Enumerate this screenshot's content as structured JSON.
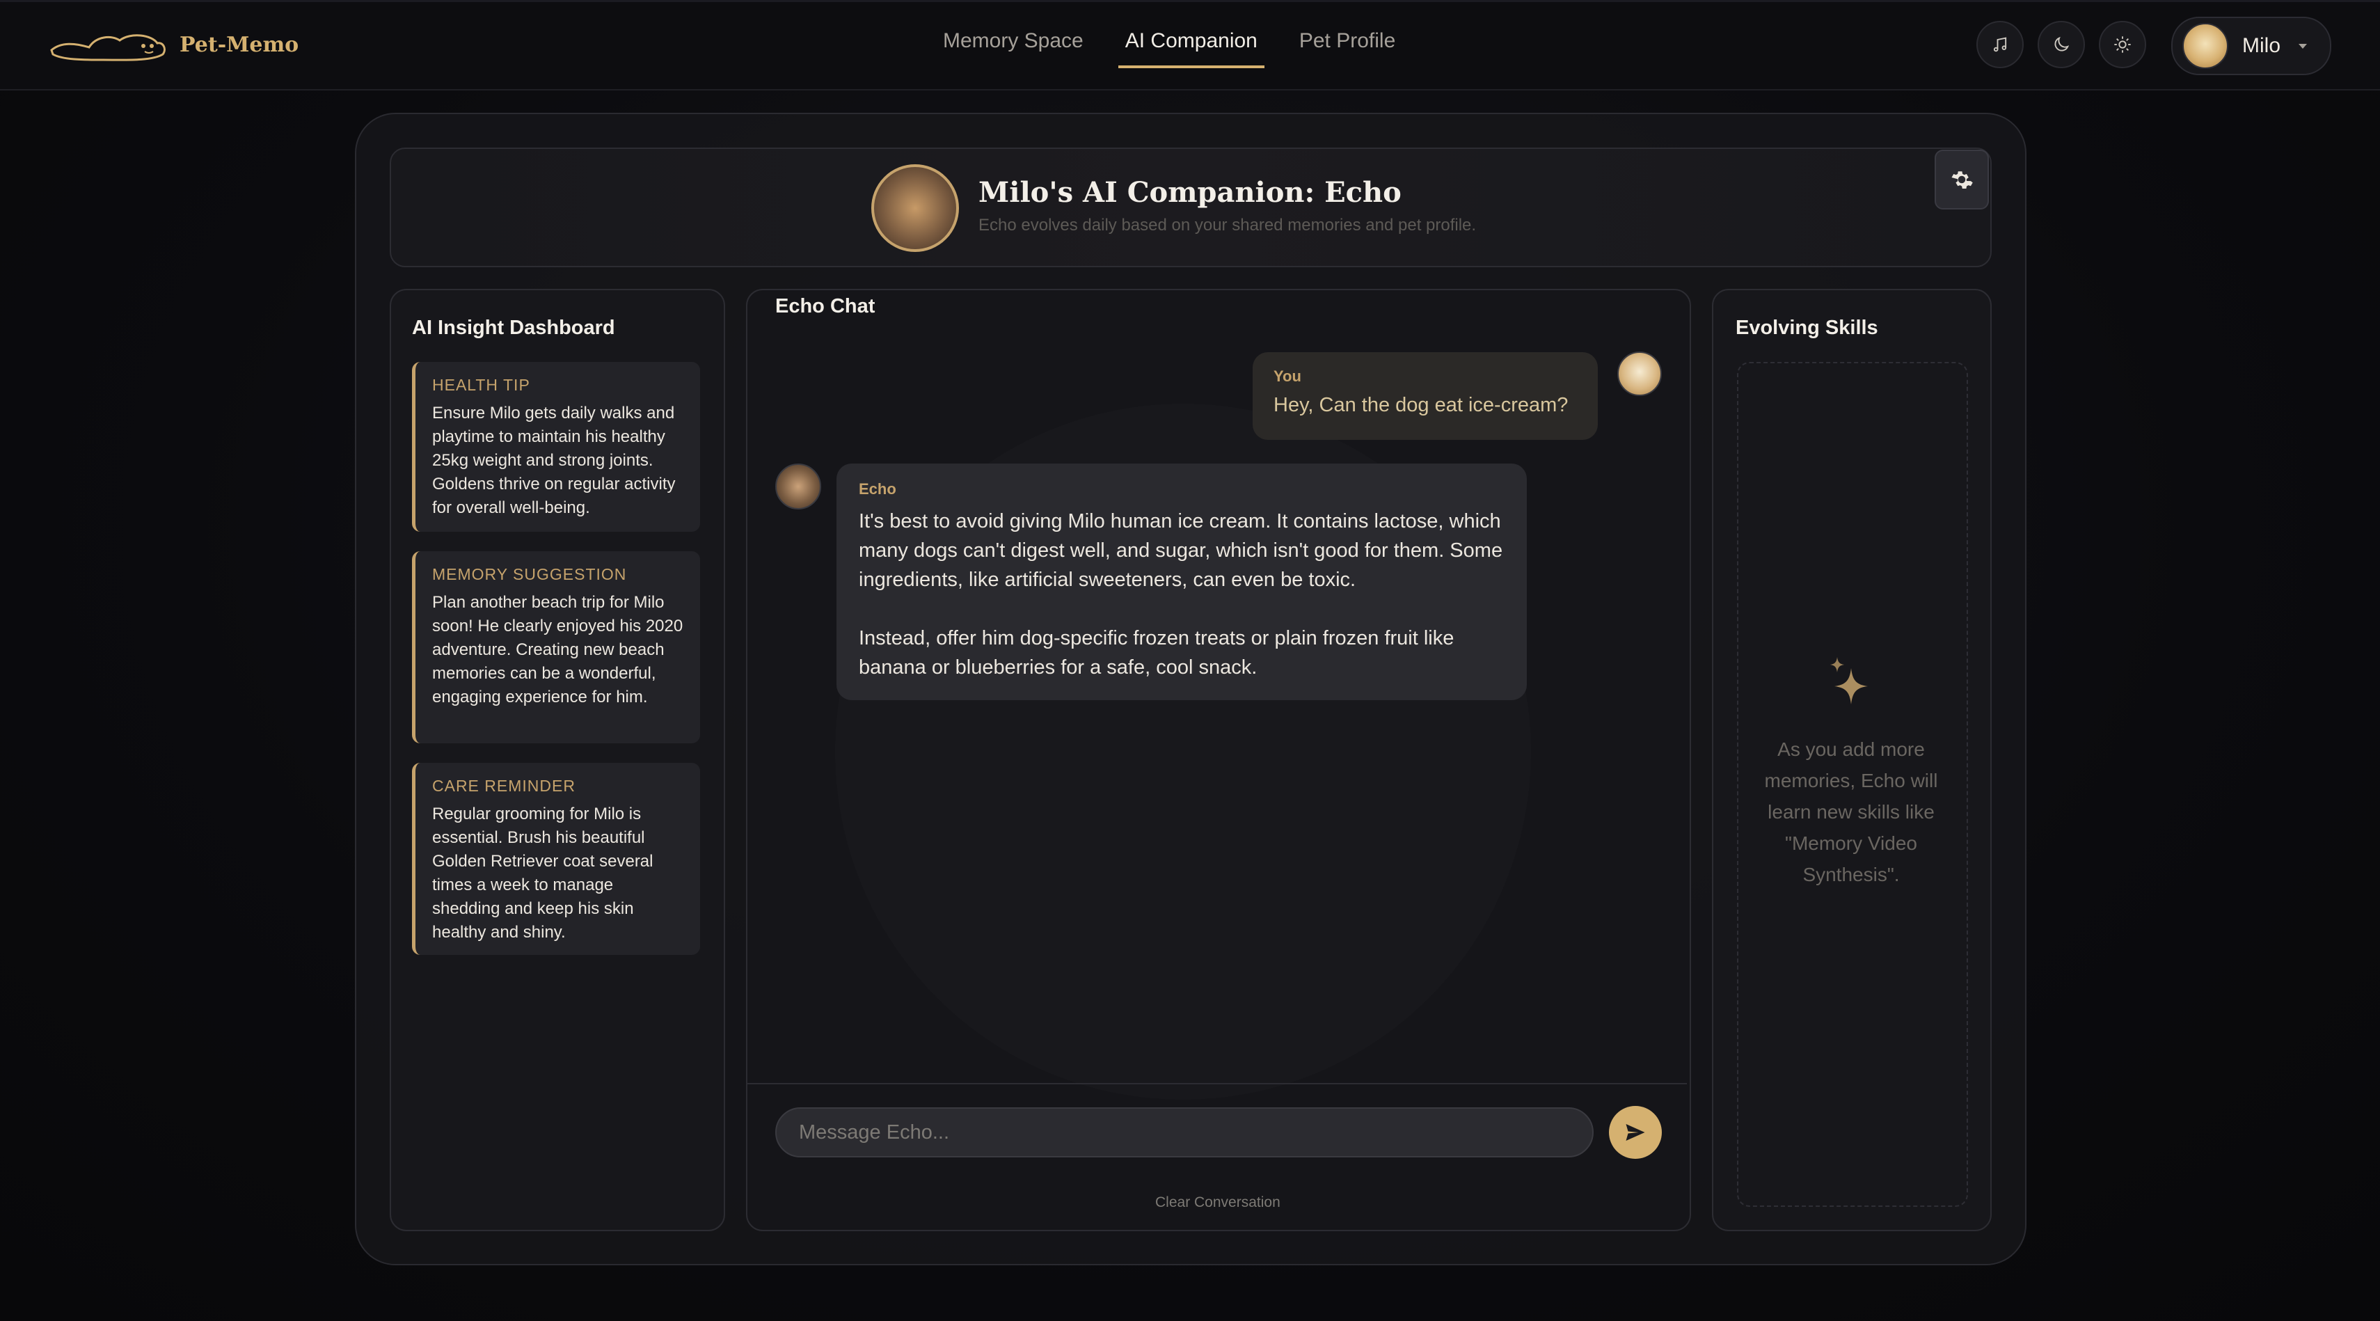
{
  "app": {
    "name": "Pet-Memo"
  },
  "nav": {
    "items": [
      "Memory Space",
      "AI Companion",
      "Pet Profile"
    ],
    "active_index": 1
  },
  "toolbar": {
    "icons": [
      "music-icon",
      "moon-icon",
      "sun-icon"
    ]
  },
  "user": {
    "name": "Milo"
  },
  "companion": {
    "title": "Milo's AI Companion: Echo",
    "subtitle": "Echo evolves daily based on your shared memories and pet profile."
  },
  "insights": {
    "title": "AI Insight Dashboard",
    "cards": [
      {
        "label": "HEALTH TIP",
        "text": "Ensure Milo gets daily walks and playtime to maintain his healthy 25kg weight and strong joints. Goldens thrive on regular activity for overall well-being."
      },
      {
        "label": "MEMORY SUGGESTION",
        "text": "Plan another beach trip for Milo soon! He clearly enjoyed his 2020 adventure. Creating new beach memories can be a wonderful, engaging experience for him."
      },
      {
        "label": "CARE REMINDER",
        "text": "Regular grooming for Milo is essential. Brush his beautiful Golden Retriever coat several times a week to manage shedding and keep his skin healthy and shiny."
      }
    ]
  },
  "chat": {
    "title": "Echo Chat",
    "messages": [
      {
        "sender": "You",
        "text": "Hey, Can the dog eat ice-cream?"
      },
      {
        "sender": "Echo",
        "text": "It's best to avoid giving Milo human ice cream. It contains lactose, which many dogs can't digest well, and sugar, which isn't good for them. Some ingredients, like artificial sweeteners, can even be toxic.\n\nInstead, offer him dog-specific frozen treats or plain frozen fruit like banana or blueberries for a safe, cool snack."
      }
    ],
    "input_placeholder": "Message Echo...",
    "clear_label": "Clear Conversation"
  },
  "skills": {
    "title": "Evolving Skills",
    "empty_text": "As you add more memories, Echo will learn new skills like \"Memory Video Synthesis\"."
  },
  "colors": {
    "accent": "#d5b170",
    "background": "#0b0b0e",
    "panel": "#17171b"
  }
}
